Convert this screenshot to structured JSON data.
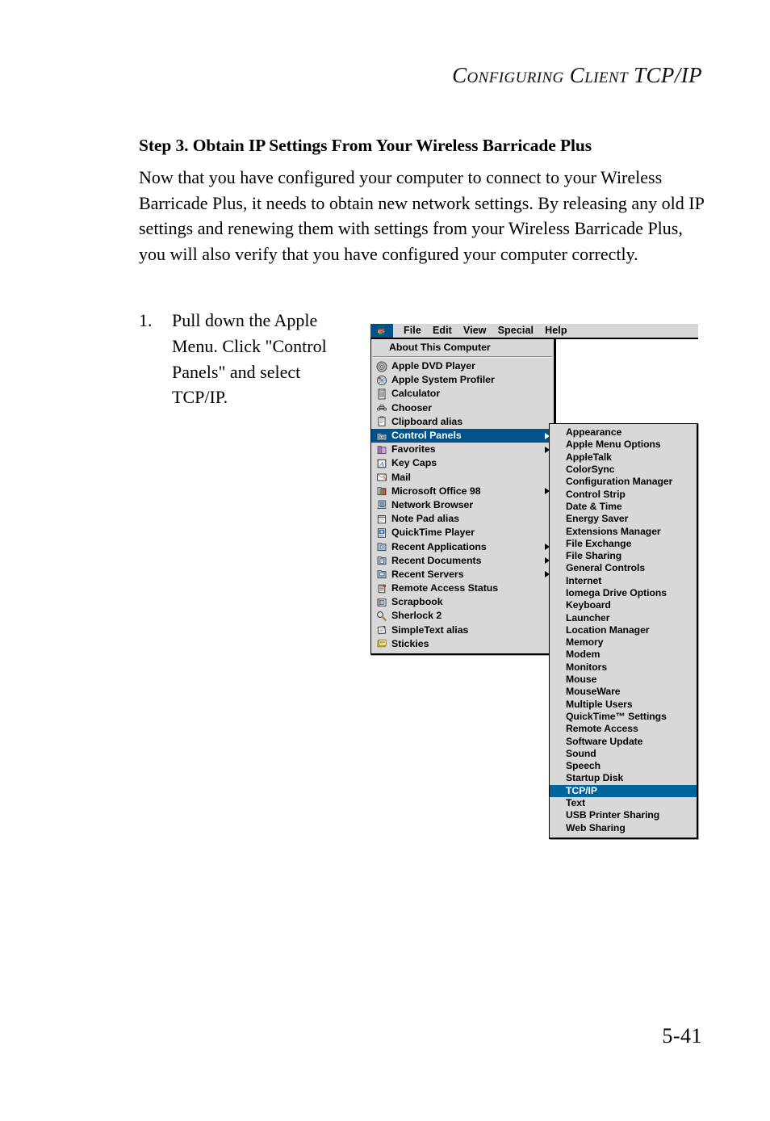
{
  "page": {
    "running_head": "Configuring Client TCP/IP",
    "running_head_parts": {
      "word1": "C",
      "word1_rest": "ONFIGURING",
      "word2": "C",
      "word2_rest": "LIENT",
      "word3": "TCP/IP"
    },
    "step_heading": "Step 3. Obtain IP Settings From Your Wireless Barricade Plus",
    "body_paragraph": "Now that you have configured your computer to connect to your Wireless Barricade Plus, it needs to obtain new network settings. By releasing any old IP settings and renewing them with settings from your Wireless Barricade Plus, you will also verify that you have configured your computer correctly.",
    "page_number": "5-41"
  },
  "list": {
    "items": [
      {
        "number": "1.",
        "text": "Pull down the Apple Menu. Click \"Control Panels\" and select TCP/IP."
      }
    ]
  },
  "screenshot": {
    "menubar": {
      "apple_icon": "apple-logo-icon",
      "items": [
        "File",
        "Edit",
        "View",
        "Special",
        "Help"
      ]
    },
    "apple_menu": {
      "about_item": "About This Computer",
      "items": [
        {
          "label": "Apple DVD Player",
          "icon": "dvd-disc-icon",
          "submenu": false,
          "selected": false
        },
        {
          "label": "Apple System Profiler",
          "icon": "system-profiler-icon",
          "submenu": false,
          "selected": false
        },
        {
          "label": "Calculator",
          "icon": "calculator-icon",
          "submenu": false,
          "selected": false
        },
        {
          "label": "Chooser",
          "icon": "chooser-icon",
          "submenu": false,
          "selected": false
        },
        {
          "label": "Clipboard alias",
          "icon": "clipboard-icon",
          "submenu": false,
          "selected": false
        },
        {
          "label": "Control Panels",
          "icon": "control-panels-icon",
          "submenu": true,
          "selected": true
        },
        {
          "label": "Favorites",
          "icon": "favorites-folder-icon",
          "submenu": true,
          "selected": false
        },
        {
          "label": "Key Caps",
          "icon": "key-caps-icon",
          "submenu": false,
          "selected": false
        },
        {
          "label": "Mail",
          "icon": "mail-icon",
          "submenu": false,
          "selected": false
        },
        {
          "label": "Microsoft Office 98",
          "icon": "office-folder-icon",
          "submenu": true,
          "selected": false
        },
        {
          "label": "Network Browser",
          "icon": "network-browser-icon",
          "submenu": false,
          "selected": false
        },
        {
          "label": "Note Pad alias",
          "icon": "note-pad-icon",
          "submenu": false,
          "selected": false
        },
        {
          "label": "QuickTime Player",
          "icon": "quicktime-icon",
          "submenu": false,
          "selected": false
        },
        {
          "label": "Recent Applications",
          "icon": "recent-apps-icon",
          "submenu": true,
          "selected": false
        },
        {
          "label": "Recent Documents",
          "icon": "recent-docs-icon",
          "submenu": true,
          "selected": false
        },
        {
          "label": "Recent Servers",
          "icon": "recent-servers-icon",
          "submenu": true,
          "selected": false
        },
        {
          "label": "Remote Access Status",
          "icon": "remote-access-icon",
          "submenu": false,
          "selected": false
        },
        {
          "label": "Scrapbook",
          "icon": "scrapbook-icon",
          "submenu": false,
          "selected": false
        },
        {
          "label": "Sherlock 2",
          "icon": "magnifier-icon",
          "submenu": false,
          "selected": false
        },
        {
          "label": "SimpleText alias",
          "icon": "simpletext-icon",
          "submenu": false,
          "selected": false
        },
        {
          "label": "Stickies",
          "icon": "stickies-icon",
          "submenu": false,
          "selected": false
        }
      ]
    },
    "control_panels_submenu": {
      "items": [
        {
          "label": "Appearance",
          "selected": false
        },
        {
          "label": "Apple Menu Options",
          "selected": false
        },
        {
          "label": "AppleTalk",
          "selected": false
        },
        {
          "label": "ColorSync",
          "selected": false
        },
        {
          "label": "Configuration Manager",
          "selected": false
        },
        {
          "label": "Control Strip",
          "selected": false
        },
        {
          "label": "Date & Time",
          "selected": false
        },
        {
          "label": "Energy Saver",
          "selected": false
        },
        {
          "label": "Extensions Manager",
          "selected": false
        },
        {
          "label": "File Exchange",
          "selected": false
        },
        {
          "label": "File Sharing",
          "selected": false
        },
        {
          "label": "General Controls",
          "selected": false
        },
        {
          "label": "Internet",
          "selected": false
        },
        {
          "label": "Iomega Drive Options",
          "selected": false
        },
        {
          "label": "Keyboard",
          "selected": false
        },
        {
          "label": "Launcher",
          "selected": false
        },
        {
          "label": "Location Manager",
          "selected": false
        },
        {
          "label": "Memory",
          "selected": false
        },
        {
          "label": "Modem",
          "selected": false
        },
        {
          "label": "Monitors",
          "selected": false
        },
        {
          "label": "Mouse",
          "selected": false
        },
        {
          "label": "MouseWare",
          "selected": false
        },
        {
          "label": "Multiple Users",
          "selected": false
        },
        {
          "label": "QuickTime™ Settings",
          "selected": false
        },
        {
          "label": "Remote Access",
          "selected": false
        },
        {
          "label": "Software Update",
          "selected": false
        },
        {
          "label": "Sound",
          "selected": false
        },
        {
          "label": "Speech",
          "selected": false
        },
        {
          "label": "Startup Disk",
          "selected": false
        },
        {
          "label": "TCP/IP",
          "selected": true
        },
        {
          "label": "Text",
          "selected": false
        },
        {
          "label": "USB Printer Sharing",
          "selected": false
        },
        {
          "label": "Web Sharing",
          "selected": false
        }
      ]
    }
  },
  "colors": {
    "highlight_blue": "#00538c",
    "submenu_highlight_blue": "#00659c",
    "menu_gray": "#d8d8d8",
    "page_background": "#ffffff",
    "text_black": "#000000"
  }
}
